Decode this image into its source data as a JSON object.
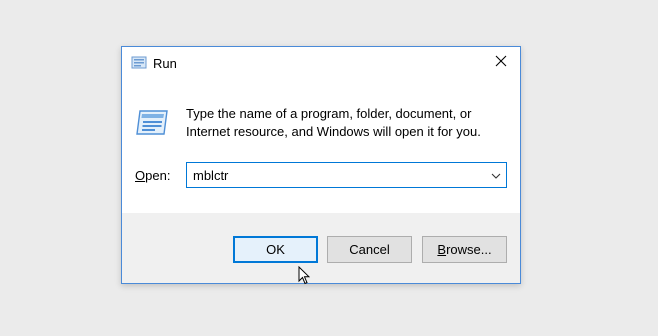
{
  "dialog": {
    "title": "Run",
    "description": "Type the name of a program, folder, document, or Internet resource, and Windows will open it for you.",
    "open_label_prefix": "O",
    "open_label_rest": "pen:",
    "open_value": "mblctr",
    "buttons": {
      "ok": "OK",
      "cancel": "Cancel",
      "browse_prefix": "B",
      "browse_rest": "rowse..."
    }
  },
  "icons": {
    "title": "run-icon",
    "large": "run-large-icon",
    "close": "close-icon",
    "dropdown": "chevron-down-icon",
    "cursor": "mouse-cursor-icon"
  },
  "colors": {
    "accent": "#0078d7",
    "window_border": "#4a8ad8",
    "desktop_bg": "#ebebeb",
    "footer_bg": "#f0f0f0",
    "button_bg": "#e1e1e1"
  }
}
